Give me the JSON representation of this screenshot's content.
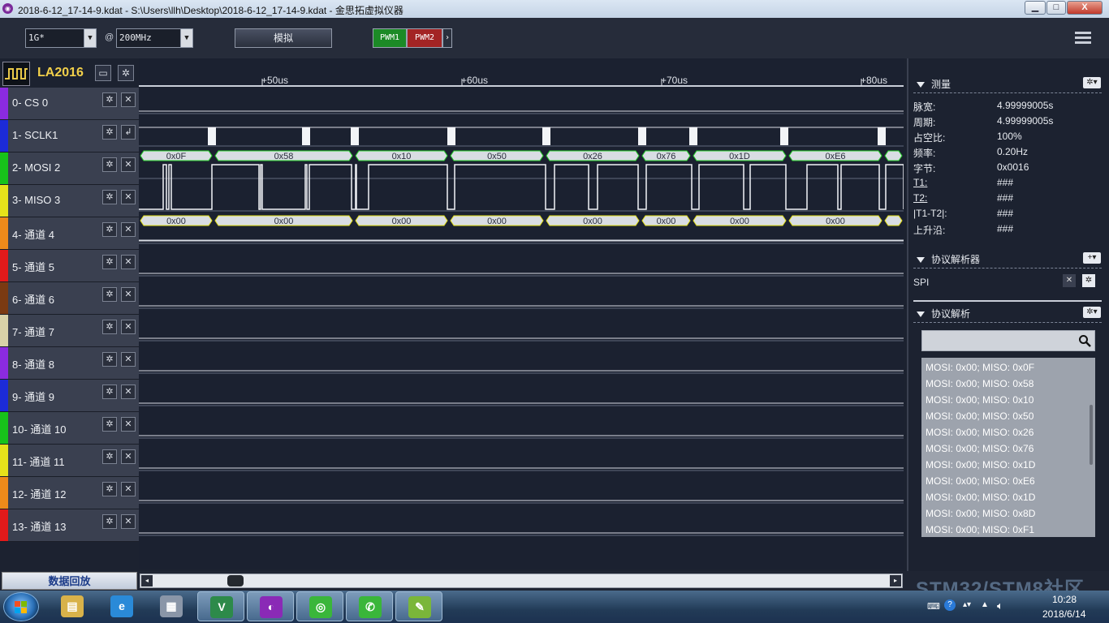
{
  "window": {
    "title": "2018-6-12_17-14-9.kdat - S:\\Users\\llh\\Desktop\\2018-6-12_17-14-9.kdat - 金思拓虚拟仪器",
    "minimize": "▁",
    "maximize": "□",
    "close": "X"
  },
  "toolbar": {
    "depth_value": "1G*",
    "at_label": "@",
    "rate_value": "200MHz",
    "simulate_label": "模拟",
    "pwm1_label": "PWM1",
    "pwm2_label": "PWM2",
    "more_glyph": "›"
  },
  "device": {
    "name": "LA2016"
  },
  "channels": [
    {
      "label": "0-  CS 0",
      "color": "#8b2be0",
      "gear": "✲",
      "action": "✕"
    },
    {
      "label": "1-  SCLK1",
      "color": "#1c2bd8",
      "gear": "✲",
      "action": "↲"
    },
    {
      "label": "2-  MOSI 2",
      "color": "#17c21a",
      "gear": "✲",
      "action": "✕"
    },
    {
      "label": "3-  MISO 3",
      "color": "#e6e21a",
      "gear": "✲",
      "action": "✕"
    },
    {
      "label": "4-  通道 4",
      "color": "#ee8a1a",
      "gear": "✲",
      "action": "✕"
    },
    {
      "label": "5-  通道 5",
      "color": "#e21a1a",
      "gear": "✲",
      "action": "✕"
    },
    {
      "label": "6-  通道 6",
      "color": "#7a3a12",
      "gear": "✲",
      "action": "✕"
    },
    {
      "label": "7-  通道 7",
      "color": "#d8d2a8",
      "gear": "✲",
      "action": "✕"
    },
    {
      "label": "8-  通道 8",
      "color": "#8b2be0",
      "gear": "✲",
      "action": "✕"
    },
    {
      "label": "9-  通道 9",
      "color": "#1c2bd8",
      "gear": "✲",
      "action": "✕"
    },
    {
      "label": "10- 通道 10",
      "color": "#17c21a",
      "gear": "✲",
      "action": "✕"
    },
    {
      "label": "11- 通道 11",
      "color": "#e6e21a",
      "gear": "✲",
      "action": "✕"
    },
    {
      "label": "12- 通道 12",
      "color": "#ee8a1a",
      "gear": "✲",
      "action": "✕"
    },
    {
      "label": "13- 通道 13",
      "color": "#e21a1a",
      "gear": "✲",
      "action": "✕"
    }
  ],
  "timeline": {
    "ticks": [
      "+50us",
      "+60us",
      "+70us",
      "+80us"
    ]
  },
  "decode": {
    "mosi_bytes": [
      "0x0F",
      "0x58",
      "0x10",
      "0x50",
      "0x26",
      "0x76",
      "0x1D",
      "0xE6"
    ],
    "miso_bytes": [
      "0x00",
      "0x00",
      "0x00",
      "0x00",
      "0x00",
      "0x00",
      "0x00",
      "0x00"
    ]
  },
  "measure": {
    "section_title": "测量",
    "rows": [
      {
        "k": "脉宽:",
        "v": "4.99999005s"
      },
      {
        "k": "周期:",
        "v": "4.99999005s"
      },
      {
        "k": "占空比:",
        "v": "100%"
      },
      {
        "k": "频率:",
        "v": "0.20Hz"
      },
      {
        "k": "字节:",
        "v": "0x0016"
      },
      {
        "k": "T1:",
        "v": "###"
      },
      {
        "k": "T2:",
        "v": "###"
      },
      {
        "k": "|T1-T2|:",
        "v": "###"
      },
      {
        "k": "上升沿:",
        "v": "###"
      }
    ]
  },
  "protocol_decoders": {
    "section_title": "协议解析器",
    "add_glyph": "+",
    "items": [
      {
        "name": "SPI"
      }
    ]
  },
  "protocol_results": {
    "section_title": "协议解析",
    "search_placeholder": "",
    "items": [
      "MOSI: 0x00;  MISO: 0x0F",
      "MOSI: 0x00;  MISO: 0x58",
      "MOSI: 0x00;  MISO: 0x10",
      "MOSI: 0x00;  MISO: 0x50",
      "MOSI: 0x00;  MISO: 0x26",
      "MOSI: 0x00;  MISO: 0x76",
      "MOSI: 0x00;  MISO: 0x1D",
      "MOSI: 0x00;  MISO: 0xE6",
      "MOSI: 0x00;  MISO: 0x1D",
      "MOSI: 0x00;  MISO: 0x8D",
      "MOSI: 0x00;  MISO: 0xF1"
    ]
  },
  "bottom": {
    "playback_label": "数据回放"
  },
  "watermark": "STM32/STM8社区",
  "tray": {
    "time": "10:28",
    "date": "2018/6/14"
  },
  "taskbar": {
    "apps": [
      {
        "icon": "explorer-icon",
        "color": "#d8b24a"
      },
      {
        "icon": "ie-icon",
        "color": "#2a8ad8"
      },
      {
        "icon": "calculator-icon",
        "color": "#8a96a8"
      },
      {
        "icon": "v5-icon",
        "color": "#2d8a4a"
      },
      {
        "icon": "analyzer-icon",
        "color": "#8a2ab6"
      },
      {
        "icon": "browser-icon",
        "color": "#3ab63a"
      },
      {
        "icon": "wechat-icon",
        "color": "#3ab63a"
      },
      {
        "icon": "notepad-icon",
        "color": "#7ab63a"
      }
    ]
  }
}
